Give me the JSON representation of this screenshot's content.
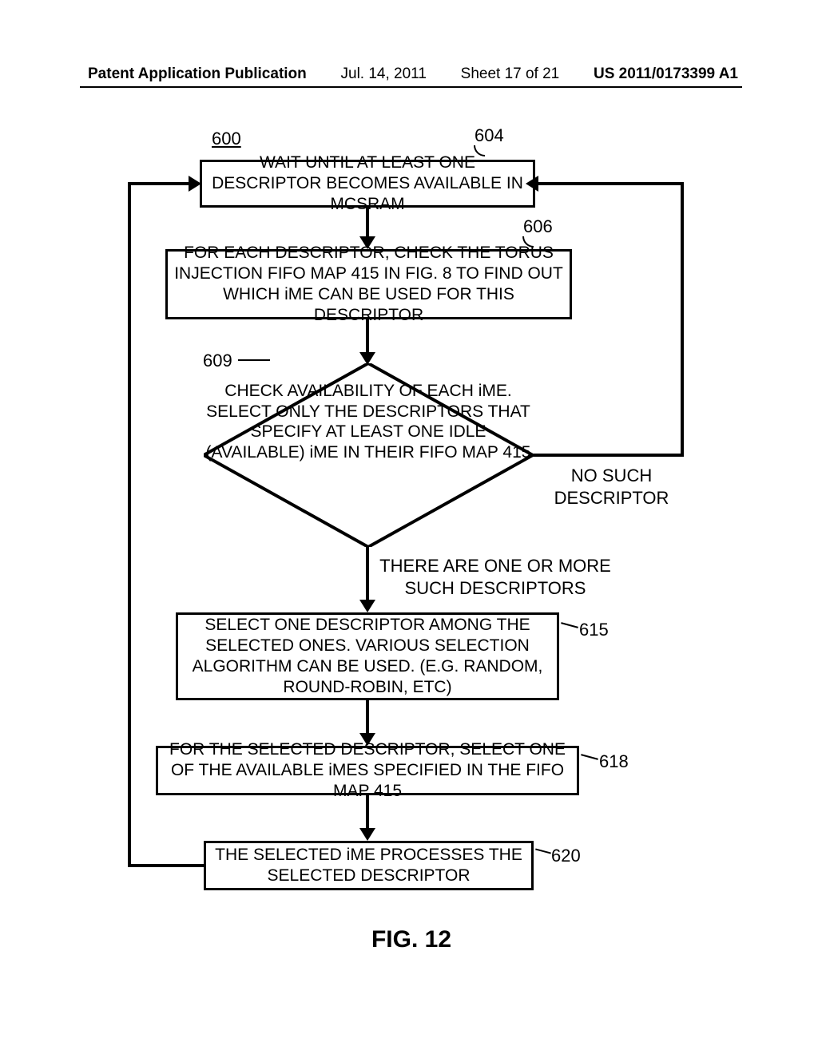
{
  "header": {
    "pub": "Patent Application Publication",
    "date": "Jul. 14, 2011",
    "sheet": "Sheet 17 of 21",
    "appno": "US 2011/0173399 A1"
  },
  "labels": {
    "l600": "600",
    "l604": "604",
    "l606": "606",
    "l609": "609",
    "l615": "615",
    "l618": "618",
    "l620": "620"
  },
  "boxes": {
    "b604": "WAIT UNTIL AT LEAST ONE DESCRIPTOR BECOMES AVAILABLE IN MCSRAM",
    "b606": "FOR EACH DESCRIPTOR, CHECK THE TORUS INJECTION FIFO MAP 415 IN FIG. 8 TO FIND OUT WHICH iME CAN BE USED FOR THIS DESCRIPTOR",
    "d609": "CHECK AVAILABILITY OF EACH iME. SELECT ONLY THE DESCRIPTORS THAT SPECIFY AT LEAST ONE IDLE (AVAILABLE) iME IN THEIR FIFO MAP 415",
    "no_branch": "NO SUCH DESCRIPTOR",
    "yes_branch": "THERE ARE ONE OR MORE SUCH DESCRIPTORS",
    "b615": "SELECT ONE DESCRIPTOR AMONG THE SELECTED ONES.  VARIOUS SELECTION ALGORITHM CAN BE USED.  (E.G. RANDOM, ROUND-ROBIN, ETC)",
    "b618": "FOR THE SELECTED DESCRIPTOR, SELECT ONE OF THE AVAILABLE iMES SPECIFIED IN THE FIFO MAP 415",
    "b620": "THE SELECTED iME PROCESSES THE SELECTED DESCRIPTOR"
  },
  "figure": "FIG. 12"
}
